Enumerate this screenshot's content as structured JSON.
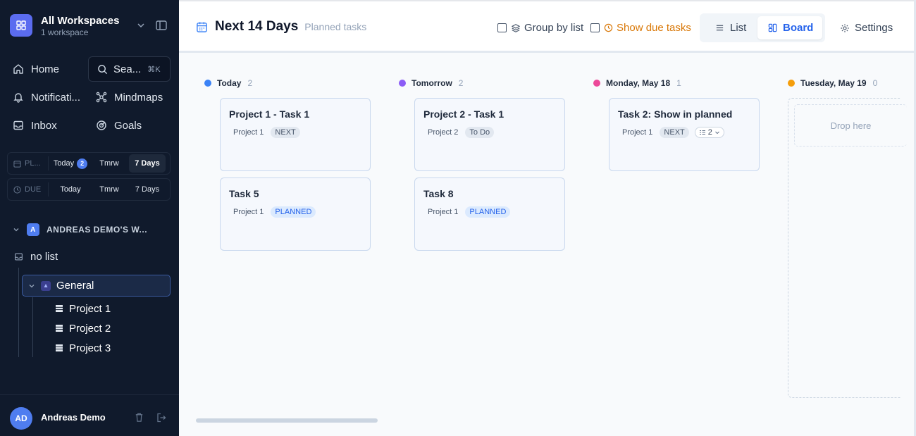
{
  "sidebar": {
    "workspace_title": "All Workspaces",
    "workspace_sub": "1 workspace",
    "nav": {
      "home": "Home",
      "search": "Sea...",
      "search_kbd": "⌘K",
      "notifications": "Notificati...",
      "mindmaps": "Mindmaps",
      "inbox": "Inbox",
      "goals": "Goals"
    },
    "planned_filter": {
      "label": "PL...",
      "today": "Today",
      "today_count": "2",
      "tomorrow": "Tmrw",
      "days7": "7 Days"
    },
    "due_filter": {
      "label": "DUE",
      "today": "Today",
      "tomorrow": "Tmrw",
      "days7": "7 Days"
    },
    "workspace_section": {
      "initial": "A",
      "name": "ANDREAS DEMO'S W..."
    },
    "no_list": "no list",
    "folder": "General",
    "projects": [
      "Project 1",
      "Project 2",
      "Project 3"
    ],
    "user": {
      "initials": "AD",
      "name": "Andreas Demo"
    }
  },
  "header": {
    "title": "Next 14 Days",
    "subtitle": "Planned tasks",
    "group_by_list": "Group by list",
    "show_due_tasks": "Show due tasks",
    "view_list": "List",
    "view_board": "Board",
    "settings": "Settings"
  },
  "board": {
    "columns": [
      {
        "name": "Today",
        "count": "2",
        "color": "#3b82f6",
        "cards": [
          {
            "title": "Project 1 - Task 1",
            "project": "Project 1",
            "status": "NEXT"
          },
          {
            "title": "Task 5",
            "project": "Project 1",
            "status": "PLANNED"
          }
        ]
      },
      {
        "name": "Tomorrow",
        "count": "2",
        "color": "#8b5cf6",
        "cards": [
          {
            "title": "Project 2 - Task 1",
            "project": "Project 2",
            "status": "To Do"
          },
          {
            "title": "Task 8",
            "project": "Project 1",
            "status": "PLANNED"
          }
        ]
      },
      {
        "name": "Monday, May 18",
        "count": "1",
        "color": "#ec4899",
        "cards": [
          {
            "title": "Task 2: Show in planned",
            "project": "Project 1",
            "status": "NEXT",
            "subtasks": "2"
          }
        ]
      },
      {
        "name": "Tuesday, May 19",
        "count": "0",
        "color": "#f59e0b",
        "drop_text": "Drop here"
      }
    ]
  },
  "colors": {
    "sidebar_bg": "#101a2c",
    "accent": "#2563eb",
    "due_orange": "#d97706"
  }
}
